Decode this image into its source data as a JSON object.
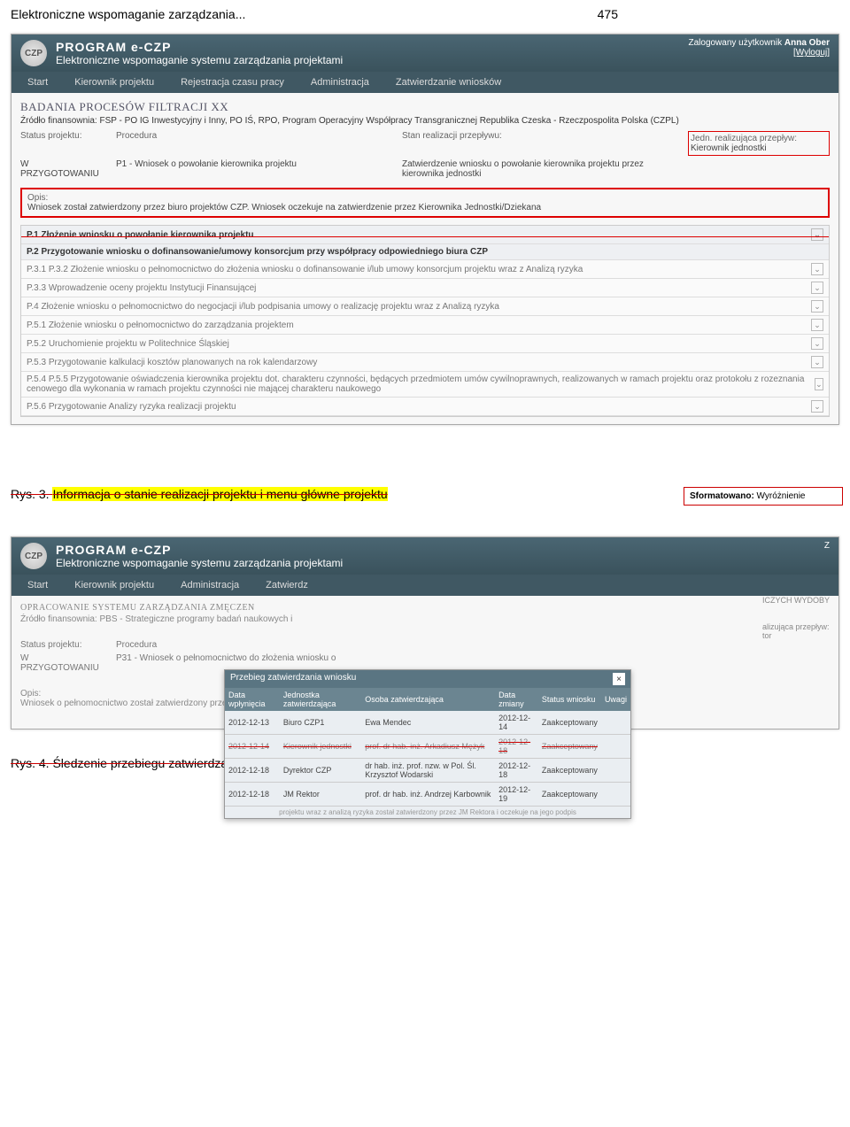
{
  "page_header": {
    "left": "Elektroniczne wspomaganie zarządzania...",
    "right": "475"
  },
  "app1": {
    "program_name": "PROGRAM e-CZP",
    "subtitle": "Elektroniczne wspomaganie systemu zarządzania projektami",
    "user_label": "Zalogowany użytkownik",
    "user_name": "Anna Ober",
    "logout": "[Wyloguj]",
    "nav": [
      "Start",
      "Kierownik projektu",
      "Rejestracja czasu pracy",
      "Administracja",
      "Zatwierdzanie wniosków"
    ],
    "project_title": "BADANIA PROCESÓW FILTRACJI XX",
    "funding": "Źródło finansownia: FSP - PO IG Inwestycyjny i Inny, PO IŚ, RPO, Program Operacyjny Współpracy Transgranicznej Republika Czeska - Rzeczpospolita Polska (CZPL)",
    "status": {
      "l1": "Status projektu:",
      "l2": "Procedura",
      "l3": "Stan realizacji przepływu:",
      "l4": "Jedn. realizująca przepływ:",
      "v1": "W PRZYGOTOWANIU",
      "v2": "P1 - Wniosek o powołanie kierownika projektu",
      "v3": "Zatwierdzenie wniosku o powołanie kierownika projektu przez kierownika jednostki",
      "v4": "Kierownik jednostki"
    },
    "opis_label": "Opis:",
    "opis_text": "Wniosek został zatwierdzony przez biuro projektów CZP. Wniosek oczekuje na zatwierdzenie przez Kierownika Jednostki/Dziekana",
    "procedures": [
      "P.1 Złożenie wniosku o powołanie kierownika projektu",
      "P.2 Przygotowanie wniosku o dofinansowanie/umowy konsorcjum przy współpracy odpowiedniego biura CZP",
      "P.3.1 P.3.2 Złożenie wniosku o pełnomocnictwo do złożenia wniosku o dofinansowanie i/lub umowy konsorcjum projektu wraz z Analizą ryzyka",
      "P.3.3 Wprowadzenie oceny projektu Instytucji Finansującej",
      "P.4 Złożenie wniosku o pełnomocnictwo do negocjacji i/lub podpisania umowy o realizację projektu wraz z Analizą ryzyka",
      "P.5.1 Złożenie wniosku o pełnomocnictwo do zarządzania projektem",
      "P.5.2 Uruchomienie projektu w Politechnice Śląskiej",
      "P.5.3 Przygotowanie kalkulacji kosztów planowanych na rok kalendarzowy",
      "P.5.4 P.5.5 Przygotowanie oświadczenia kierownika projektu dot. charakteru czynności, będących przedmiotem umów cywilnoprawnych, realizowanych w ramach projektu oraz protokołu z rozeznania cenowego dla wykonania w ramach projektu czynności nie mającej charakteru naukowego",
      "P.5.6 Przygotowanie Analizy ryzyka realizacji projektu"
    ]
  },
  "caption1": {
    "prefix": "Rys. 3. ",
    "text": "Informacja o stanie realizacji projektu i menu główne projektu"
  },
  "comment1": {
    "label": "Sformatowano:",
    "text": " Wyróżnienie"
  },
  "app2": {
    "program_name": "PROGRAM e-CZP",
    "subtitle": "Elektroniczne wspomaganie systemu zarządzania projektami",
    "nav": [
      "Start",
      "Kierownik projektu",
      "Administracja",
      "Zatwierdz"
    ],
    "project_title": "OPRACOWANIE SYSTEMU ZARZĄDZANIA ZMĘCZEN",
    "funding": "Źródło finansownia: PBS - Strategiczne programy badań naukowych i",
    "status_l1": "Status projektu:",
    "status_l2": "Procedura",
    "status_v1": "W PRZYGOTOWANIU",
    "status_v2": "P31 - Wniosek o pełnomocnictwo do złożenia wniosku o",
    "opis_label": "Opis:",
    "opis_text": "Wniosek o pełnomocnictwo został zatwierdzony przez JM Rektora i oczekuje na jego podpis",
    "right_tail": "ICZYCH WYDOBY",
    "right_label": "alizująca przepływ:",
    "right_val": "tor",
    "modal": {
      "title": "Przebieg zatwierdzania wniosku",
      "headers": [
        "Data wpłynięcia",
        "Jednostka zatwierdzająca",
        "Osoba zatwierdzająca",
        "Data zmiany",
        "Status wniosku",
        "Uwagi"
      ],
      "rows": [
        [
          "2012-12-13",
          "Biuro CZP1",
          "Ewa Mendec",
          "2012-12-14",
          "Zaakceptowany",
          ""
        ],
        [
          "2012-12-14",
          "Kierownik jednostki",
          "prof. dr hab. inż. Arkadiusz Mężyk",
          "2012-12-18",
          "Zaakceptowany",
          ""
        ],
        [
          "2012-12-18",
          "Dyrektor CZP",
          "dr hab. inż. prof. nzw. w Pol. Śl. Krzysztof Wodarski",
          "2012-12-18",
          "Zaakceptowany",
          ""
        ],
        [
          "2012-12-18",
          "JM Rektor",
          "prof. dr hab. inż. Andrzej Karbownik",
          "2012-12-19",
          "Zaakceptowany",
          ""
        ]
      ],
      "footer": "projektu wraz z analizą ryzyka został zatwierdzony przez JM Rektora i oczekuje na jego podpis"
    }
  },
  "caption2": {
    "prefix": "Rys. 4. ",
    "text": "Śledzenie przebiegu zatwierdzania wniosku"
  }
}
